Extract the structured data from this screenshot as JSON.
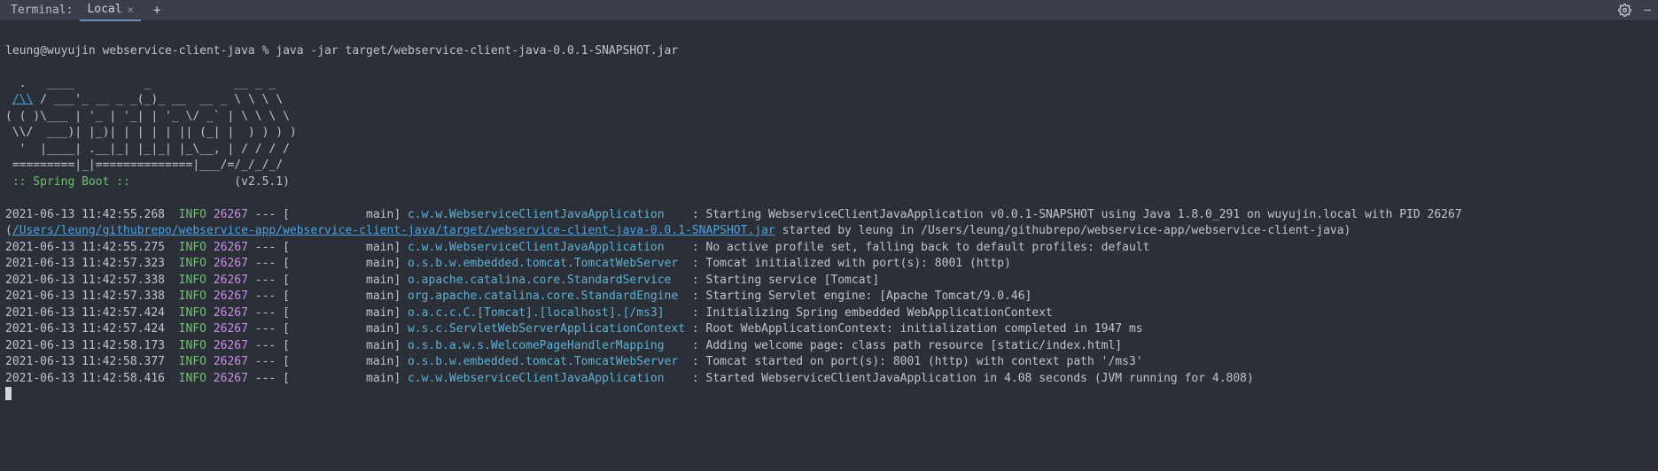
{
  "header": {
    "title": "Terminal:",
    "tab_label": "Local",
    "close_glyph": "×",
    "add_glyph": "+",
    "gear_name": "gear-icon",
    "minimize_glyph": "—"
  },
  "prompt": "leung@wuyujin webservice-client-java % java -jar target/webservice-client-java-0.0.1-SNAPSHOT.jar",
  "ascii": {
    "l0": "  .   ____          _            __ _ _",
    "l1_a": " ",
    "l1_link": "/\\\\",
    "l1_b": " / ___'_ __ _ _(_)_ __  __ _ \\ \\ \\ \\",
    "l2": "( ( )\\___ | '_ | '_| | '_ \\/ _` | \\ \\ \\ \\",
    "l3": " \\\\/  ___)| |_)| | | | | || (_| |  ) ) ) )",
    "l4": "  '  |____| .__|_| |_|_| |_\\__, | / / / /",
    "l5": " =========|_|==============|___/=/_/_/_/"
  },
  "spring": {
    "label": " :: Spring Boot ::",
    "spacer": "               ",
    "version": "(v2.5.1)"
  },
  "path_link": "/Users/leung/githubrepo/webservice-app/webservice-client-java/target/webservice-client-java-0.0.1-SNAPSHOT.jar",
  "logs": [
    {
      "ts": "2021-06-13 11:42:55.268",
      "level": "INFO",
      "pid": "26267",
      "thread": " --- [           main] ",
      "logger": "c.w.w.WebserviceClientJavaApplication   ",
      "msg_pre": " : Starting WebserviceClientJavaApplication v0.0.1-SNAPSHOT using Java 1.8.0_291 on wuyujin.local with PID 26267 (",
      "msg_post": " started by leung in /Users/leung/githubrepo/webservice-app/webservice-client-java)",
      "has_link": true
    },
    {
      "ts": "2021-06-13 11:42:55.275",
      "level": "INFO",
      "pid": "26267",
      "thread": " --- [           main] ",
      "logger": "c.w.w.WebserviceClientJavaApplication   ",
      "msg": " : No active profile set, falling back to default profiles: default"
    },
    {
      "ts": "2021-06-13 11:42:57.323",
      "level": "INFO",
      "pid": "26267",
      "thread": " --- [           main] ",
      "logger": "o.s.b.w.embedded.tomcat.TomcatWebServer ",
      "msg": " : Tomcat initialized with port(s): 8001 (http)"
    },
    {
      "ts": "2021-06-13 11:42:57.338",
      "level": "INFO",
      "pid": "26267",
      "thread": " --- [           main] ",
      "logger": "o.apache.catalina.core.StandardService  ",
      "msg": " : Starting service [Tomcat]"
    },
    {
      "ts": "2021-06-13 11:42:57.338",
      "level": "INFO",
      "pid": "26267",
      "thread": " --- [           main] ",
      "logger": "org.apache.catalina.core.StandardEngine ",
      "msg": " : Starting Servlet engine: [Apache Tomcat/9.0.46]"
    },
    {
      "ts": "2021-06-13 11:42:57.424",
      "level": "INFO",
      "pid": "26267",
      "thread": " --- [           main] ",
      "logger": "o.a.c.c.C.[Tomcat].[localhost].[/ms3]   ",
      "msg": " : Initializing Spring embedded WebApplicationContext"
    },
    {
      "ts": "2021-06-13 11:42:57.424",
      "level": "INFO",
      "pid": "26267",
      "thread": " --- [           main] ",
      "logger": "w.s.c.ServletWebServerApplicationContext",
      "msg": " : Root WebApplicationContext: initialization completed in 1947 ms"
    },
    {
      "ts": "2021-06-13 11:42:58.173",
      "level": "INFO",
      "pid": "26267",
      "thread": " --- [           main] ",
      "logger": "o.s.b.a.w.s.WelcomePageHandlerMapping   ",
      "msg": " : Adding welcome page: class path resource [static/index.html]"
    },
    {
      "ts": "2021-06-13 11:42:58.377",
      "level": "INFO",
      "pid": "26267",
      "thread": " --- [           main] ",
      "logger": "o.s.b.w.embedded.tomcat.TomcatWebServer ",
      "msg": " : Tomcat started on port(s): 8001 (http) with context path '/ms3'"
    },
    {
      "ts": "2021-06-13 11:42:58.416",
      "level": "INFO",
      "pid": "26267",
      "thread": " --- [           main] ",
      "logger": "c.w.w.WebserviceClientJavaApplication   ",
      "msg": " : Started WebserviceClientJavaApplication in 4.08 seconds (JVM running for 4.808)"
    }
  ]
}
